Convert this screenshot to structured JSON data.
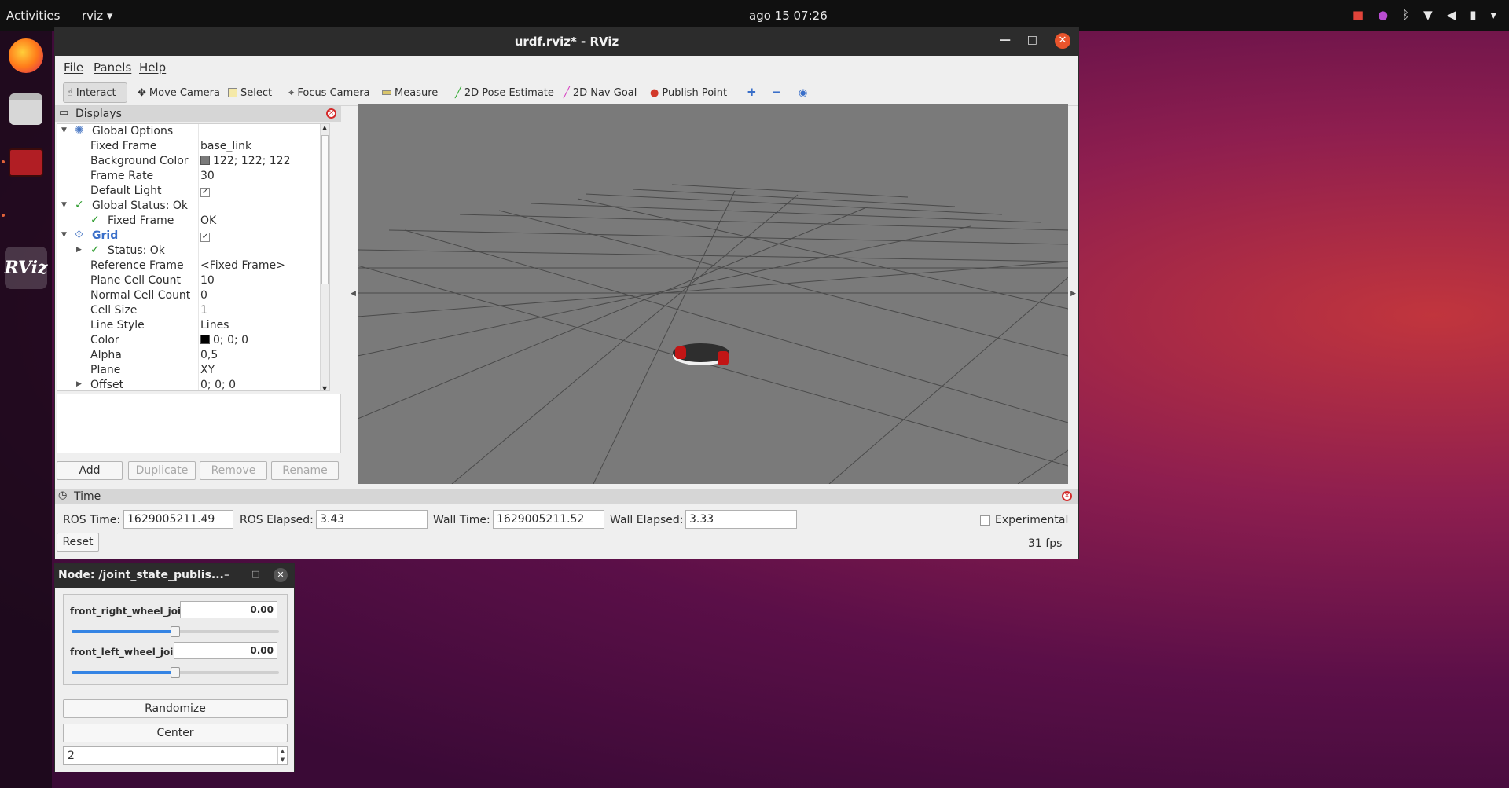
{
  "topbar": {
    "activities": "Activities",
    "app_menu": "rviz ▾",
    "clock": "ago 15 07:26"
  },
  "dock": {
    "items": [
      "firefox-icon",
      "files-icon",
      "terminal-icon",
      "rviz-icon"
    ],
    "rviz_label": "RViz"
  },
  "window": {
    "title": "urdf.rviz* - RViz",
    "menu": [
      "File",
      "Panels",
      "Help"
    ],
    "toolbar": [
      "Interact",
      "Move Camera",
      "Select",
      "Focus Camera",
      "Measure",
      "2D Pose Estimate",
      "2D Nav Goal",
      "Publish Point"
    ]
  },
  "displays": {
    "title": "Displays",
    "rows": [
      {
        "key": "Global Options",
        "value": ""
      },
      {
        "key": "Fixed Frame",
        "value": "base_link"
      },
      {
        "key": "Background Color",
        "value": "122; 122; 122"
      },
      {
        "key": "Frame Rate",
        "value": "30"
      },
      {
        "key": "Default Light",
        "value": ""
      },
      {
        "key": "Global Status: Ok",
        "value": ""
      },
      {
        "key": "Fixed Frame",
        "value": "OK"
      },
      {
        "key": "Grid",
        "value": ""
      },
      {
        "key": "Status: Ok",
        "value": ""
      },
      {
        "key": "Reference Frame",
        "value": "<Fixed Frame>"
      },
      {
        "key": "Plane Cell Count",
        "value": "10"
      },
      {
        "key": "Normal Cell Count",
        "value": "0"
      },
      {
        "key": "Cell Size",
        "value": "1"
      },
      {
        "key": "Line Style",
        "value": "Lines"
      },
      {
        "key": "Color",
        "value": "0; 0; 0"
      },
      {
        "key": "Alpha",
        "value": "0,5"
      },
      {
        "key": "Plane",
        "value": "XY"
      },
      {
        "key": "Offset",
        "value": "0; 0; 0"
      }
    ],
    "buttons": [
      "Add",
      "Duplicate",
      "Remove",
      "Rename"
    ],
    "bg_color": "#7a7a7a",
    "grid_color": "#000000"
  },
  "time": {
    "title": "Time",
    "ros_time_label": "ROS Time:",
    "ros_time": "1629005211.49",
    "ros_elapsed_label": "ROS Elapsed:",
    "ros_elapsed": "3.43",
    "wall_time_label": "Wall Time:",
    "wall_time": "1629005211.52",
    "wall_elapsed_label": "Wall Elapsed:",
    "wall_elapsed": "3.33",
    "experimental": "Experimental",
    "reset": "Reset",
    "fps": "31 fps"
  },
  "jsp": {
    "title": "Node: /joint_state_publis...",
    "joints": [
      {
        "name": "front_right_wheel_joint",
        "value": "0.00",
        "slider_fraction": 0.5
      },
      {
        "name": "front_left_wheel_joint",
        "value": "0.00",
        "slider_fraction": 0.5
      }
    ],
    "randomize": "Randomize",
    "center": "Center",
    "spin_value": "2"
  }
}
